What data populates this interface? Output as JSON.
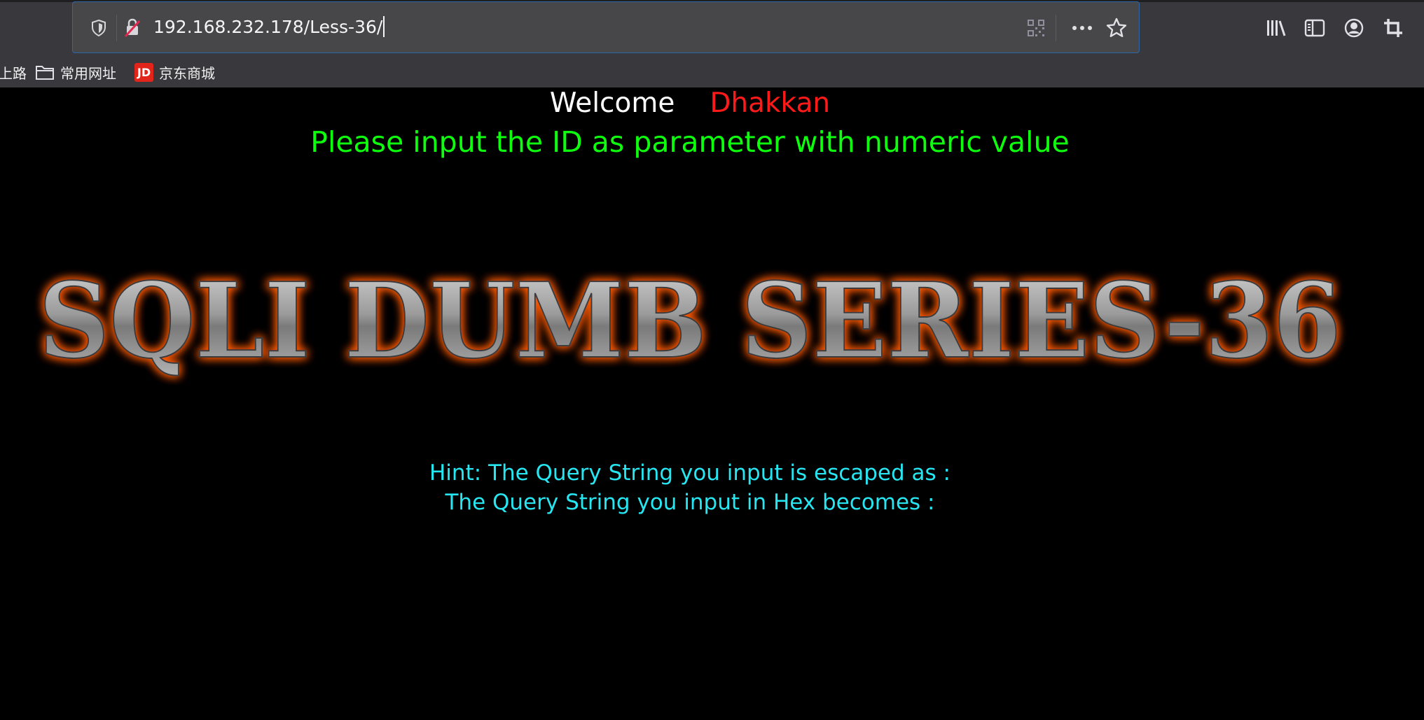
{
  "browser": {
    "url": "192.168.232.178/Less-36/",
    "bookmarks": [
      {
        "label": "上路"
      },
      {
        "label": "常用网址"
      },
      {
        "label": "京东商城",
        "logo_text": "JD"
      }
    ]
  },
  "page": {
    "welcome": "Welcome",
    "username": "Dhakkan",
    "instruction": "Please input the ID as parameter with numeric value",
    "banner_text": "SQLI DUMB SERIES-36",
    "hint_escaped": "Hint: The Query String you input is escaped as :",
    "hint_hex": "The Query String you input in Hex becomes :"
  },
  "colors": {
    "background": "#000000",
    "welcome": "#ffffff",
    "username": "#ff1a1a",
    "instruction": "#0dff0d",
    "hint": "#26e6f2",
    "banner_glow": "#ff5a00",
    "banner_fill": "#9a9a9a"
  },
  "icons": {
    "urlbar": [
      "shield-icon",
      "insecure-connection-icon",
      "qr-code-icon",
      "more-actions-icon",
      "bookmark-star-icon"
    ],
    "toolbar": [
      "library-icon",
      "sidebar-icon",
      "account-icon",
      "crop-screenshot-icon"
    ]
  }
}
